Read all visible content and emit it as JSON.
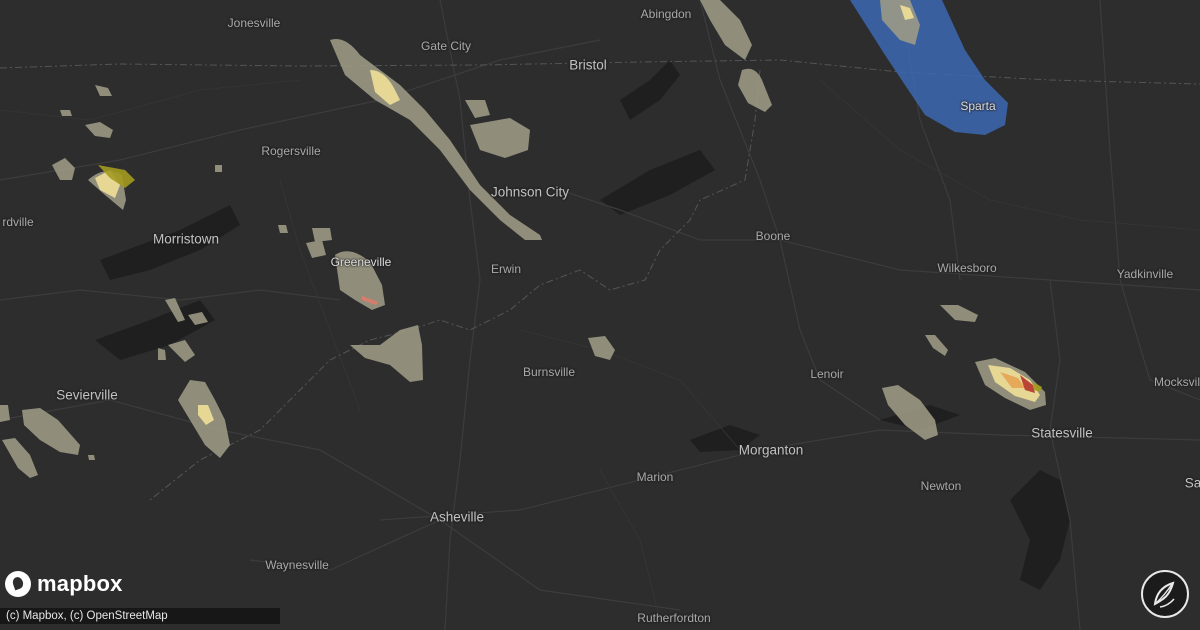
{
  "map": {
    "attribution": "(c) Mapbox, (c) OpenStreetMap",
    "logo_text": "mapbox",
    "colors": {
      "background": "#2d2d2d",
      "hail_light": "#9e9c86",
      "hail_moderate": "#f0df97",
      "hail_heavy": "#e6a756",
      "hail_severe": "#b5342a",
      "hail_green": "#a39a1f",
      "wind_blue": "#3d68b3"
    },
    "cities": [
      {
        "name": "Jonesville",
        "size": "minor"
      },
      {
        "name": "Gate City",
        "size": "minor"
      },
      {
        "name": "Abingdon",
        "size": "minor"
      },
      {
        "name": "Bristol",
        "size": "major"
      },
      {
        "name": "Sparta",
        "size": "minor"
      },
      {
        "name": "Rogersville",
        "size": "minor"
      },
      {
        "name": "Johnson City",
        "size": "major"
      },
      {
        "name": "rdville",
        "size": "minor"
      },
      {
        "name": "Morristown",
        "size": "major"
      },
      {
        "name": "Greeneville",
        "size": "minor"
      },
      {
        "name": "Erwin",
        "size": "minor"
      },
      {
        "name": "Boone",
        "size": "minor"
      },
      {
        "name": "Wilkesboro",
        "size": "minor"
      },
      {
        "name": "Yadkinville",
        "size": "minor"
      },
      {
        "name": "Sevierville",
        "size": "major"
      },
      {
        "name": "Burnsville",
        "size": "minor"
      },
      {
        "name": "Lenoir",
        "size": "minor"
      },
      {
        "name": "Mocksvil",
        "size": "minor"
      },
      {
        "name": "Statesville",
        "size": "major"
      },
      {
        "name": "Morganton",
        "size": "major"
      },
      {
        "name": "Marion",
        "size": "minor"
      },
      {
        "name": "Newton",
        "size": "minor"
      },
      {
        "name": "Asheville",
        "size": "major"
      },
      {
        "name": "Sa",
        "size": "major"
      },
      {
        "name": "Waynesville",
        "size": "minor"
      },
      {
        "name": "Rutherfordton",
        "size": "minor"
      }
    ]
  }
}
